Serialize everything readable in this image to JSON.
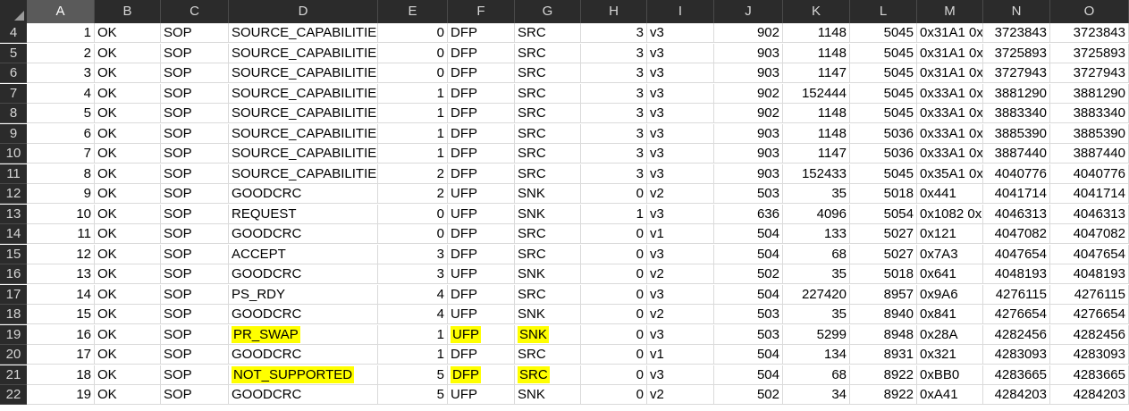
{
  "column_letters": [
    "A",
    "B",
    "C",
    "D",
    "E",
    "F",
    "G",
    "H",
    "I",
    "J",
    "K",
    "L",
    "M",
    "N",
    "O"
  ],
  "selected_column": "A",
  "highlight_color": "#ffff00",
  "rows": [
    {
      "n": "4",
      "cells": [
        "1",
        "OK",
        "SOP",
        "SOURCE_CAPABILITIES",
        "0",
        "DFP",
        "SRC",
        "3",
        "v3",
        "902",
        "1148",
        "5045",
        "0x31A1 0x",
        "3723843",
        "3723843"
      ]
    },
    {
      "n": "5",
      "cells": [
        "2",
        "OK",
        "SOP",
        "SOURCE_CAPABILITIES",
        "0",
        "DFP",
        "SRC",
        "3",
        "v3",
        "903",
        "1148",
        "5045",
        "0x31A1 0x",
        "3725893",
        "3725893"
      ]
    },
    {
      "n": "6",
      "cells": [
        "3",
        "OK",
        "SOP",
        "SOURCE_CAPABILITIES",
        "0",
        "DFP",
        "SRC",
        "3",
        "v3",
        "903",
        "1147",
        "5045",
        "0x31A1 0x",
        "3727943",
        "3727943"
      ]
    },
    {
      "n": "7",
      "cells": [
        "4",
        "OK",
        "SOP",
        "SOURCE_CAPABILITIES",
        "1",
        "DFP",
        "SRC",
        "3",
        "v3",
        "902",
        "152444",
        "5045",
        "0x33A1 0x",
        "3881290",
        "3881290"
      ]
    },
    {
      "n": "8",
      "cells": [
        "5",
        "OK",
        "SOP",
        "SOURCE_CAPABILITIES",
        "1",
        "DFP",
        "SRC",
        "3",
        "v3",
        "902",
        "1148",
        "5045",
        "0x33A1 0x",
        "3883340",
        "3883340"
      ]
    },
    {
      "n": "9",
      "cells": [
        "6",
        "OK",
        "SOP",
        "SOURCE_CAPABILITIES",
        "1",
        "DFP",
        "SRC",
        "3",
        "v3",
        "903",
        "1148",
        "5036",
        "0x33A1 0x",
        "3885390",
        "3885390"
      ]
    },
    {
      "n": "10",
      "cells": [
        "7",
        "OK",
        "SOP",
        "SOURCE_CAPABILITIES",
        "1",
        "DFP",
        "SRC",
        "3",
        "v3",
        "903",
        "1147",
        "5036",
        "0x33A1 0x",
        "3887440",
        "3887440"
      ]
    },
    {
      "n": "11",
      "cells": [
        "8",
        "OK",
        "SOP",
        "SOURCE_CAPABILITIES",
        "2",
        "DFP",
        "SRC",
        "3",
        "v3",
        "903",
        "152433",
        "5045",
        "0x35A1 0x",
        "4040776",
        "4040776"
      ]
    },
    {
      "n": "12",
      "cells": [
        "9",
        "OK",
        "SOP",
        "GOODCRC",
        "2",
        "UFP",
        "SNK",
        "0",
        "v2",
        "503",
        "35",
        "5018",
        "0x441",
        "4041714",
        "4041714"
      ]
    },
    {
      "n": "13",
      "cells": [
        "10",
        "OK",
        "SOP",
        "REQUEST",
        "0",
        "UFP",
        "SNK",
        "1",
        "v3",
        "636",
        "4096",
        "5054",
        "0x1082 0x",
        "4046313",
        "4046313"
      ]
    },
    {
      "n": "14",
      "cells": [
        "11",
        "OK",
        "SOP",
        "GOODCRC",
        "0",
        "DFP",
        "SRC",
        "0",
        "v1",
        "504",
        "133",
        "5027",
        "0x121",
        "4047082",
        "4047082"
      ]
    },
    {
      "n": "15",
      "cells": [
        "12",
        "OK",
        "SOP",
        "ACCEPT",
        "3",
        "DFP",
        "SRC",
        "0",
        "v3",
        "504",
        "68",
        "5027",
        "0x7A3",
        "4047654",
        "4047654"
      ]
    },
    {
      "n": "16",
      "cells": [
        "13",
        "OK",
        "SOP",
        "GOODCRC",
        "3",
        "UFP",
        "SNK",
        "0",
        "v2",
        "502",
        "35",
        "5018",
        "0x641",
        "4048193",
        "4048193"
      ]
    },
    {
      "n": "17",
      "cells": [
        "14",
        "OK",
        "SOP",
        "PS_RDY",
        "4",
        "DFP",
        "SRC",
        "0",
        "v3",
        "504",
        "227420",
        "8957",
        "0x9A6",
        "4276115",
        "4276115"
      ]
    },
    {
      "n": "18",
      "cells": [
        "15",
        "OK",
        "SOP",
        "GOODCRC",
        "4",
        "UFP",
        "SNK",
        "0",
        "v2",
        "503",
        "35",
        "8940",
        "0x841",
        "4276654",
        "4276654"
      ]
    },
    {
      "n": "19",
      "cells": [
        "16",
        "OK",
        "SOP",
        "PR_SWAP",
        "1",
        "UFP",
        "SNK",
        "0",
        "v3",
        "503",
        "5299",
        "8948",
        "0x28A",
        "4282456",
        "4282456"
      ],
      "highlight": [
        3,
        5,
        6
      ]
    },
    {
      "n": "20",
      "cells": [
        "17",
        "OK",
        "SOP",
        "GOODCRC",
        "1",
        "DFP",
        "SRC",
        "0",
        "v1",
        "504",
        "134",
        "8931",
        "0x321",
        "4283093",
        "4283093"
      ]
    },
    {
      "n": "21",
      "cells": [
        "18",
        "OK",
        "SOP",
        "NOT_SUPPORTED",
        "5",
        "DFP",
        "SRC",
        "0",
        "v3",
        "504",
        "68",
        "8922",
        "0xBB0",
        "4283665",
        "4283665"
      ],
      "highlight": [
        3,
        5,
        6
      ]
    },
    {
      "n": "22",
      "cells": [
        "19",
        "OK",
        "SOP",
        "GOODCRC",
        "5",
        "UFP",
        "SNK",
        "0",
        "v2",
        "502",
        "34",
        "8922",
        "0xA41",
        "4284203",
        "4284203"
      ]
    }
  ]
}
